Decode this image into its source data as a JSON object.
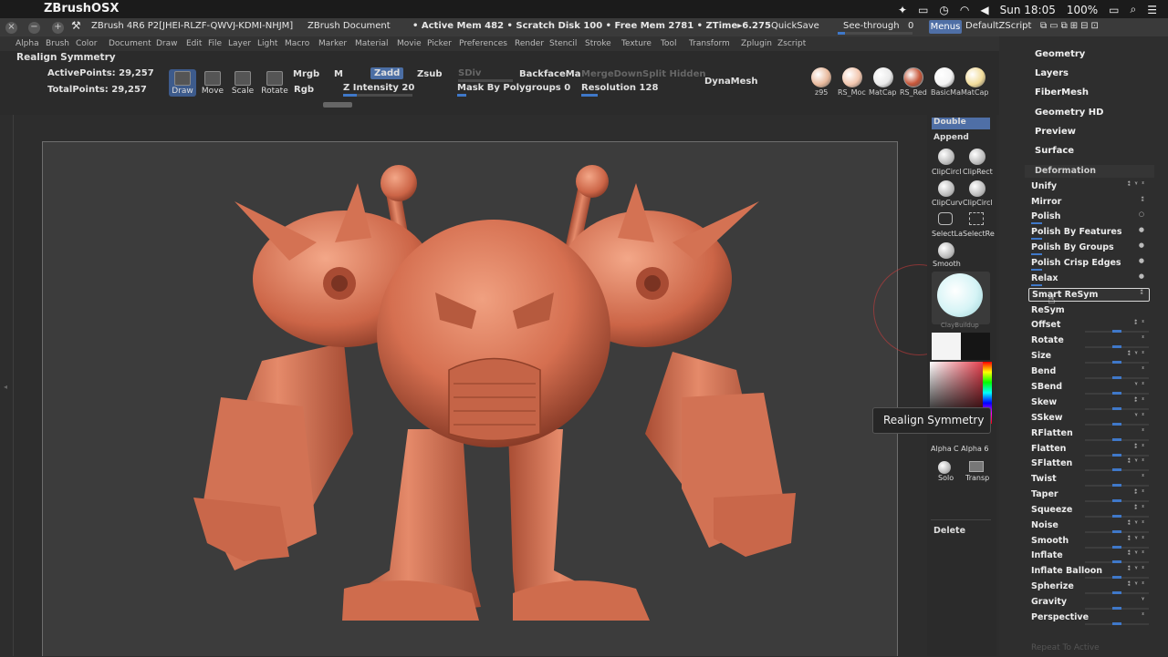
{
  "macbar": {
    "app_name": "ZBrushOSX",
    "clock": "Sun 18:05",
    "battery": "100%"
  },
  "titlebar": {
    "doc_title": "ZBrush 4R6 P2[JHEI-RLZF-QWVJ-KDMI-NHJM]",
    "doc_label": "ZBrush Document",
    "status": "• Active Mem 482 • Scratch Disk 100 • Free Mem 2781 • ZTime▸6.275",
    "quicksave": "QuickSave",
    "seethrough": "See-through",
    "seethrough_value": "0",
    "menus": "Menus",
    "defaultzscript": "DefaultZScript"
  },
  "menu_items": [
    "Alpha",
    "Brush",
    "Color",
    "Document",
    "Draw",
    "Edit",
    "File",
    "Layer",
    "Light",
    "Macro",
    "Marker",
    "Material",
    "Movie",
    "Picker",
    "Preferences",
    "Render",
    "Stencil",
    "Stroke",
    "Texture",
    "Tool",
    "Transform",
    "Zplugin",
    "Zscript"
  ],
  "shelf": {
    "realign": "Realign Symmetry",
    "active_points": "ActivePoints: 29,257",
    "total_points": "TotalPoints: 29,257",
    "draw": "Draw",
    "move": "Move",
    "scale": "Scale",
    "rotate": "Rotate",
    "mrgb": "Mrgb",
    "rgb": "Rgb",
    "m": "M",
    "zadd": "Zadd",
    "zsub": "Zsub",
    "sdiv": "SDiv",
    "z_intensity": "Z Intensity 20",
    "backface": "BackfaceMa",
    "mergedown": "MergeDown",
    "split_hidden": "Split Hidden",
    "mask_by_polygroups": "Mask By Polygroups 0",
    "resolution": "Resolution 128",
    "dynamesh": "DynaMesh",
    "z_intensity_level": 0.2,
    "materials": [
      {
        "label": "z95",
        "color": "#e8b99c"
      },
      {
        "label": "RS_Moc",
        "color": "#f2c6ae"
      },
      {
        "label": "MatCap",
        "color": "#e9e9e9"
      },
      {
        "label": "RS_Red",
        "color": "#c8573a"
      },
      {
        "label": "BasicMa",
        "color": "#f4f4f4"
      },
      {
        "label": "MatCap",
        "color": "#f2dc9a"
      }
    ]
  },
  "midtray": {
    "double": "Double",
    "append": "Append",
    "clipcircle": "ClipCircl",
    "cliprect": "ClipRect",
    "clipcurve": "ClipCurv",
    "clipcircle2": "ClipCircl",
    "selectlasso": "SelectLa",
    "selectrect": "SelectRe",
    "smooth": "Smooth",
    "claybuildup": "ClayBuildup",
    "alpha": "Alpha",
    "c_alpha": "C Alpha 6",
    "solo": "Solo",
    "transp": "Transp",
    "delete": "Delete"
  },
  "right_panel": {
    "headers": [
      "Geometry",
      "Layers",
      "FiberMesh",
      "Geometry HD",
      "Preview",
      "Surface"
    ],
    "deformation": "Deformation",
    "items": [
      {
        "label": "Unify",
        "icons": "⁑ ᵞ ᶻ",
        "slider": null
      },
      {
        "label": "Mirror",
        "icons": "⁑",
        "slider": null
      },
      {
        "label": "Polish",
        "icons": "○",
        "slider": null
      },
      {
        "label": "Polish By Features",
        "icons": "●",
        "slider": null
      },
      {
        "label": "Polish By Groups",
        "icons": "●",
        "slider": null
      },
      {
        "label": "Polish Crisp Edges",
        "icons": "●",
        "slider": null
      },
      {
        "label": "Relax",
        "icons": "●",
        "slider": null
      },
      {
        "label": "Smart ReSym",
        "icons": "⁑",
        "slider": null
      },
      {
        "label": "ReSym",
        "icons": "",
        "slider": null
      },
      {
        "label": "Offset",
        "icons": "⁑ ᶻ",
        "slider": 0.5
      },
      {
        "label": "Rotate",
        "icons": "ᶻ",
        "slider": 0.5
      },
      {
        "label": "Size",
        "icons": "⁑ ᵞ ᶻ",
        "slider": 0.5
      },
      {
        "label": "Bend",
        "icons": "ᶻ",
        "slider": 0.5
      },
      {
        "label": "SBend",
        "icons": "ᵞ ᶻ",
        "slider": 0.5
      },
      {
        "label": "Skew",
        "icons": "⁑ ᶻ",
        "slider": 0.5
      },
      {
        "label": "SSkew",
        "icons": "ᵞ ᶻ",
        "slider": 0.5
      },
      {
        "label": "RFlatten",
        "icons": "ᶻ",
        "slider": 0.5
      },
      {
        "label": "Flatten",
        "icons": "⁑ ᶻ",
        "slider": 0.5
      },
      {
        "label": "SFlatten",
        "icons": "⁑ ᵞ ᶻ",
        "slider": 0.5
      },
      {
        "label": "Twist",
        "icons": "ᶻ",
        "slider": 0.5
      },
      {
        "label": "Taper",
        "icons": "⁑ ᶻ",
        "slider": 0.5
      },
      {
        "label": "Squeeze",
        "icons": "⁑ ᶻ",
        "slider": 0.5
      },
      {
        "label": "Noise",
        "icons": "⁑ ᵞ ᶻ",
        "slider": 0.5
      },
      {
        "label": "Smooth",
        "icons": "⁑ ᵞ ᶻ",
        "slider": 0.5
      },
      {
        "label": "Inflate",
        "icons": "⁑ ᵞ ᶻ",
        "slider": 0.5
      },
      {
        "label": "Inflate Balloon",
        "icons": "⁑ ᵞ ᶻ",
        "slider": 0.5
      },
      {
        "label": "Spherize",
        "icons": "⁑ ᵞ ᶻ",
        "slider": 0.5
      },
      {
        "label": "Gravity",
        "icons": "ᵞ",
        "slider": 0.5
      },
      {
        "label": "Perspective",
        "icons": "ᶻ",
        "slider": 0.5
      }
    ],
    "footer": "Repeat To Active"
  },
  "tooltip": "Realign Symmetry",
  "colors": {
    "accent": "#3f78c9",
    "model": "#d9785a"
  }
}
